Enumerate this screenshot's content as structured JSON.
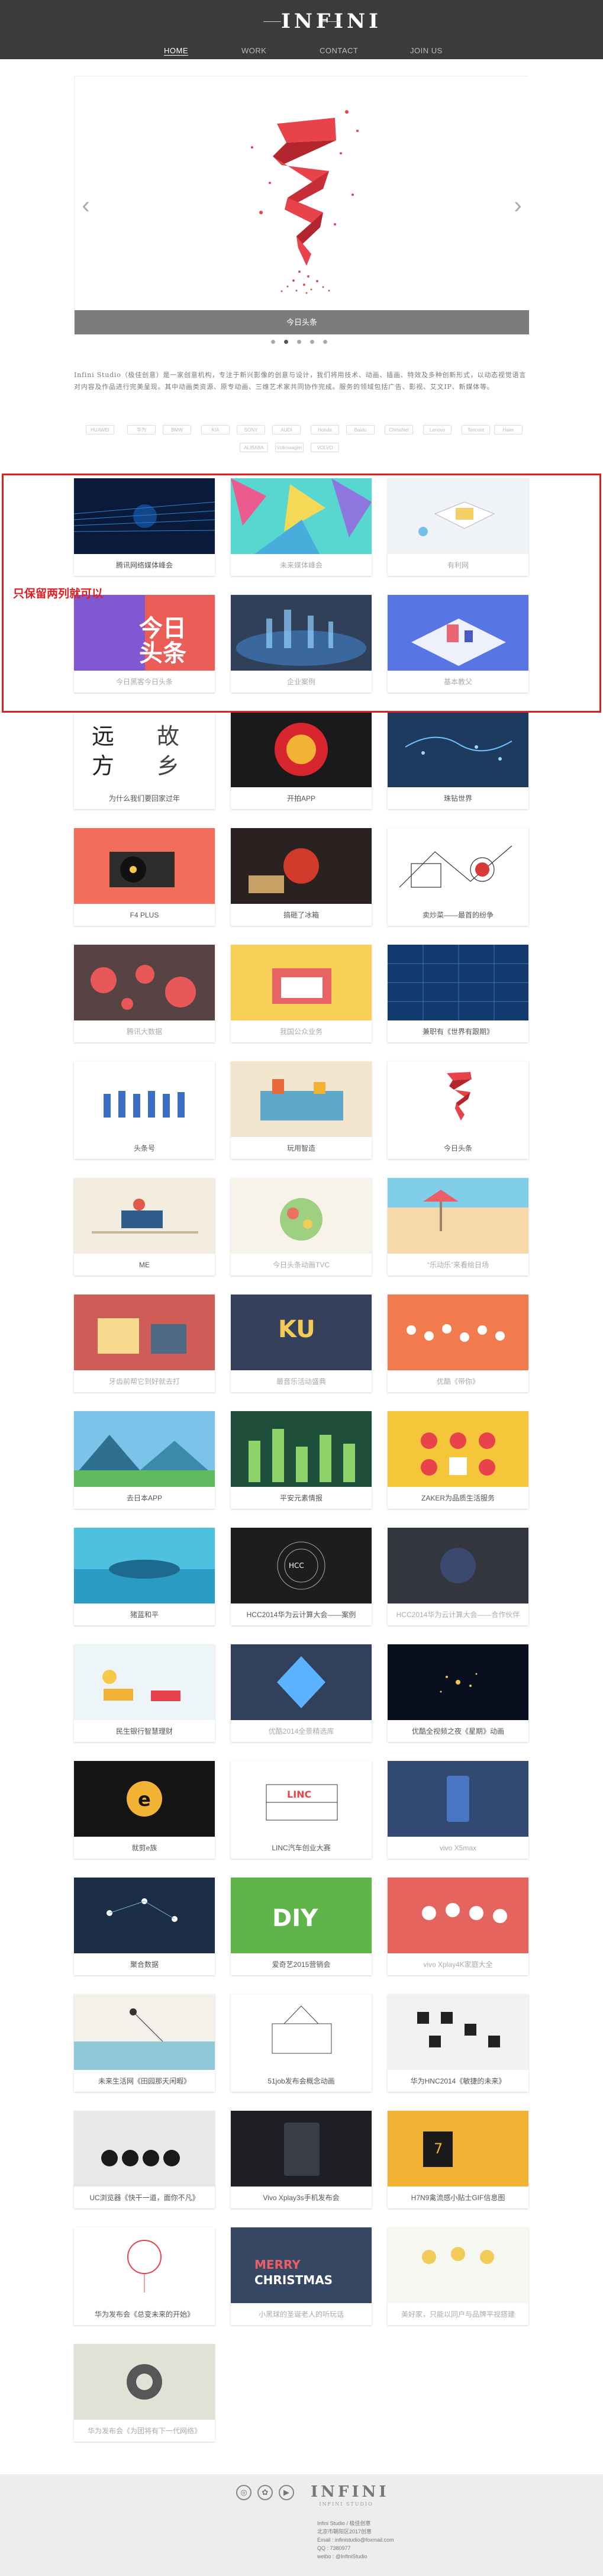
{
  "header": {
    "logo_mark": "INFINI",
    "nav": [
      "HOME",
      "WORK",
      "CONTACT",
      "JOIN US"
    ]
  },
  "slider": {
    "caption": "今日头条",
    "dots": 5,
    "active_dot": 1
  },
  "intro": {
    "text": "Infini Studio（极佳创意）是一家创意机构，专注于新兴影像的创意与设计，我们将用技术、动画、插画、特效及多种创新形式，以动态视觉语言对内容及作品进行完美呈现。其中动画类资源、原专动画、三维艺术家共同协作完成。服务的领域包括广告、影视、艾文IP、新媒体等。"
  },
  "clients": [
    "HUAWEI",
    "华为",
    "BMW",
    "KIA",
    "SONY",
    "AUDI",
    "Honda",
    "Baidu",
    "ChinaNet",
    "Lenovo",
    "Tencent",
    "Haier",
    "ALIBABA",
    "Volkswagen",
    "VOLVO"
  ],
  "works": [
    {
      "title": "腾讯网络媒体峰会",
      "faded": false,
      "theme": "blue-lines"
    },
    {
      "title": "未来媒体峰会",
      "faded": true,
      "theme": "teal-poly"
    },
    {
      "title": "有利网",
      "faded": true,
      "theme": "white-iso"
    },
    {
      "title": "今日黑客今日头条",
      "faded": true,
      "theme": "purple-head"
    },
    {
      "title": "企业案例",
      "faded": true,
      "theme": "city-blue"
    },
    {
      "title": "基本教父",
      "faded": true,
      "theme": "blue-iso"
    },
    {
      "title": "为什么我们要回家过年",
      "faded": false,
      "theme": "calligraphy"
    },
    {
      "title": "开拍APP",
      "faded": false,
      "theme": "red-circle"
    },
    {
      "title": "珠钻世界",
      "faded": false,
      "theme": "blue-map"
    },
    {
      "title": "F4 PLUS",
      "faded": false,
      "theme": "coral-vinyl"
    },
    {
      "title": "搞砸了冰箱",
      "faded": false,
      "theme": "dark-tea"
    },
    {
      "title": "卖炒菜——最首的纷争",
      "faded": false,
      "theme": "sketch"
    },
    {
      "title": "腾讯大数据",
      "faded": true,
      "theme": "red-dots"
    },
    {
      "title": "我国公众业务",
      "faded": true,
      "theme": "yellow-stage"
    },
    {
      "title": "兼职有《世界有跟期》",
      "faded": false,
      "theme": "navy-grid"
    },
    {
      "title": "头条号",
      "faded": false,
      "theme": "people"
    },
    {
      "title": "玩用智造",
      "faded": false,
      "theme": "factory"
    },
    {
      "title": "今日头条",
      "faded": false,
      "theme": "ribbon"
    },
    {
      "title": "ME",
      "faded": false,
      "theme": "me-ship"
    },
    {
      "title": "今日头条动画TVC",
      "faded": true,
      "theme": "salad"
    },
    {
      "title": "“乐动乐”来看绘日场",
      "faded": true,
      "theme": "beach"
    },
    {
      "title": "牙齿前帮它到好就去打",
      "faded": true,
      "theme": "red-room"
    },
    {
      "title": "最音乐活动盛典",
      "faded": true,
      "theme": "ku-music"
    },
    {
      "title": "优酷《带你》",
      "faded": true,
      "theme": "crowd"
    },
    {
      "title": "去日本APP",
      "faded": false,
      "theme": "tokyo"
    },
    {
      "title": "平安元素情报",
      "faded": false,
      "theme": "green-city"
    },
    {
      "title": "ZAKER为品质生活服务",
      "faded": false,
      "theme": "zaker"
    },
    {
      "title": "猪蓝和平",
      "faded": false,
      "theme": "whale"
    },
    {
      "title": "HCC2014华为云计算大会——案例",
      "faded": false,
      "theme": "hcc-rings"
    },
    {
      "title": "HCC2014华为云计算大会——合作伙伴",
      "faded": true,
      "theme": "hcc-dark"
    },
    {
      "title": "民生银行智慧理财",
      "faded": false,
      "theme": "cars"
    },
    {
      "title": "优酷2014全景精选库",
      "faded": true,
      "theme": "blue-crystal"
    },
    {
      "title": "优酷全视频之夜《星期》动画",
      "faded": false,
      "theme": "particles"
    },
    {
      "title": "就剪e族",
      "faded": false,
      "theme": "gold-e"
    },
    {
      "title": "LINC汽车创业大赛",
      "faded": false,
      "theme": "linc"
    },
    {
      "title": "vivo X5max",
      "faded": true,
      "theme": "vivo-x5"
    },
    {
      "title": "聚合数据",
      "faded": false,
      "theme": "data-nodes"
    },
    {
      "title": "爱奇艺2015营销会",
      "faded": false,
      "theme": "diy"
    },
    {
      "title": "vivo Xplay4K家庭大全",
      "faded": true,
      "theme": "red-people"
    },
    {
      "title": "未来生活网《田园那天闲暇》",
      "faded": false,
      "theme": "fishing"
    },
    {
      "title": "51job发布会概念动画",
      "faded": false,
      "theme": "sketch-lamp"
    },
    {
      "title": "华为HNC2014《敏捷的未来》",
      "faded": false,
      "theme": "grid-bw"
    },
    {
      "title": "UC浏览器《快干一道，面你不凡》",
      "faded": false,
      "theme": "pendulum"
    },
    {
      "title": "Vivo Xplay3s手机发布会",
      "faded": false,
      "theme": "phone-dark"
    },
    {
      "title": "H7N9禽流感小贴士GIF信息图",
      "faded": false,
      "theme": "xmas-red"
    },
    {
      "title": "华为发布会《总变未来的开始》",
      "faded": false,
      "theme": "balloon"
    },
    {
      "title": "小黑球的圣诞老人的听玩话",
      "faded": true,
      "theme": "merry-xmas"
    },
    {
      "title": "美好家，只能以同户与品牌平视搭建",
      "faded": true,
      "theme": "bulbs"
    },
    {
      "title": "华为发布会《为团将有下一代网络》",
      "faded": true,
      "theme": "swirl"
    }
  ],
  "annotation": {
    "text": "只保留两列就可以"
  },
  "footer": {
    "social": [
      "weibo-icon",
      "wechat-icon",
      "play-icon"
    ],
    "logo_mark": "INFINI",
    "logo_sub": "INFINI STUDIO",
    "info": [
      "Infini Studio / 极佳创意",
      "北京市朝阳区2017创意",
      "Email : infinistudio@foxmail.com",
      "QQ : 7380977",
      "weibo : @InfiniStudio"
    ]
  }
}
